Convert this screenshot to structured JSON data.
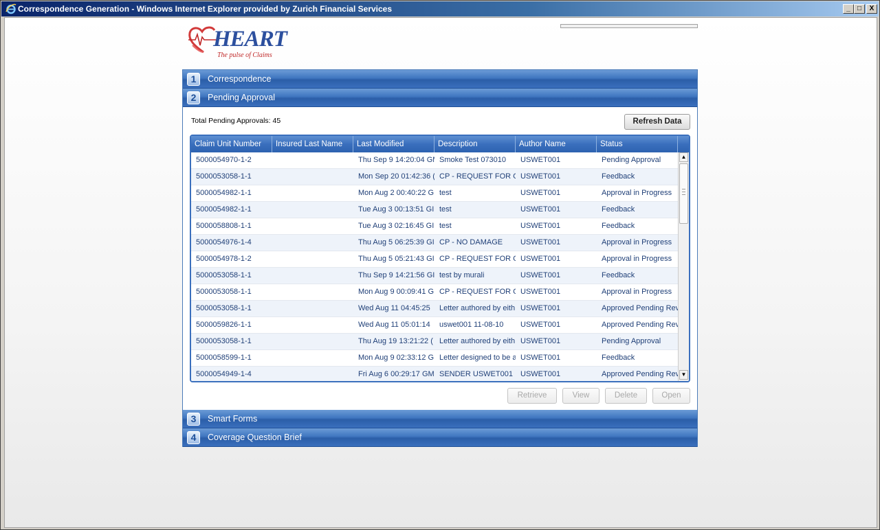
{
  "window": {
    "title": "Correspondence Generation - Windows Internet Explorer provided by Zurich Financial Services",
    "min_label": "_",
    "max_label": "□",
    "close_label": "X"
  },
  "logo": {
    "word": "HEART",
    "tagline": "The pulse of Claims"
  },
  "accordion": [
    {
      "num": "1",
      "label": "Correspondence"
    },
    {
      "num": "2",
      "label": "Pending Approval"
    },
    {
      "num": "3",
      "label": "Smart Forms"
    },
    {
      "num": "4",
      "label": "Coverage Question Brief"
    }
  ],
  "pending": {
    "total_text": "Total Pending Approvals: 45",
    "refresh_label": "Refresh Data",
    "columns": [
      "Claim Unit Number",
      "Insured Last Name",
      "Last Modified",
      "Description",
      "Author Name",
      "Status"
    ],
    "rows": [
      [
        "5000054970-1-2",
        "",
        "Thu Sep 9 14:20:04 GM",
        "Smoke Test 073010",
        "USWET001",
        "Pending Approval"
      ],
      [
        "5000053058-1-1",
        "",
        "Mon Sep 20 01:42:36 (",
        "CP - REQUEST FOR CC",
        "USWET001",
        "Feedback"
      ],
      [
        "5000054982-1-1",
        "",
        "Mon Aug 2 00:40:22 G",
        "test",
        "USWET001",
        "Approval in Progress"
      ],
      [
        "5000054982-1-1",
        "",
        "Tue Aug 3 00:13:51 GI",
        "test",
        "USWET001",
        "Feedback"
      ],
      [
        "5000058808-1-1",
        "",
        "Tue Aug 3 02:16:45 GI",
        "test",
        "USWET001",
        "Feedback"
      ],
      [
        "5000054976-1-4",
        "",
        "Thu Aug 5 06:25:39 GI",
        "CP - NO DAMAGE",
        "USWET001",
        "Approval in Progress"
      ],
      [
        "5000054978-1-2",
        "",
        "Thu Aug 5 05:21:43 GI",
        "CP - REQUEST FOR CC",
        "USWET001",
        "Approval in Progress"
      ],
      [
        "5000053058-1-1",
        "",
        "Thu Sep 9 14:21:56 GI",
        "test by murali",
        "USWET001",
        "Feedback"
      ],
      [
        "5000053058-1-1",
        "",
        "Mon Aug 9 00:09:41 G",
        "CP - REQUEST FOR CC",
        "USWET001",
        "Approval in Progress"
      ],
      [
        "5000053058-1-1",
        "",
        "Wed Aug 11 04:45:25",
        "Letter authored by eith",
        "USWET001",
        "Approved Pending Rev"
      ],
      [
        "5000059826-1-1",
        "",
        "Wed Aug 11 05:01:14",
        "uswet001 11-08-10",
        "USWET001",
        "Approved Pending Rev"
      ],
      [
        "5000053058-1-1",
        "",
        "Thu Aug 19 13:21:22 (",
        "Letter authored by eith",
        "USWET001",
        "Pending Approval"
      ],
      [
        "5000058599-1-1",
        "",
        "Mon Aug 9 02:33:12 G",
        "Letter designed to be a",
        "USWET001",
        "Feedback"
      ],
      [
        "5000054949-1-4",
        "",
        "Fri Aug 6 00:29:17 GM",
        "SENDER USWET001",
        "USWET001",
        "Approved Pending Rev"
      ]
    ],
    "buttons": {
      "retrieve": "Retrieve",
      "view": "View",
      "delete": "Delete",
      "open": "Open"
    }
  },
  "colors": {
    "accordion_blue": "#3a6fbd",
    "row_text": "#1f3f77",
    "logo_blue": "#2c4f9e",
    "logo_red": "#c02828"
  }
}
